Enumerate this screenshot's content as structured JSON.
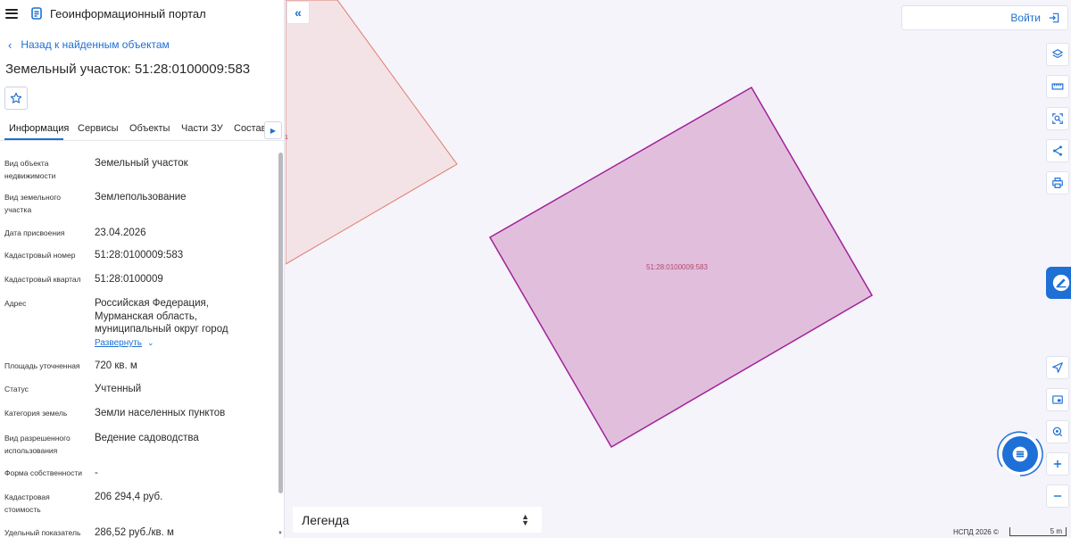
{
  "app": {
    "title": "Геоинформационный портал"
  },
  "nav": {
    "back_label": "Назад к найденным объектам"
  },
  "object": {
    "title": "Земельный участок: 51:28:0100009:583"
  },
  "tabs": [
    {
      "label": "Информация",
      "active": true
    },
    {
      "label": "Сервисы",
      "active": false
    },
    {
      "label": "Объекты",
      "active": false
    },
    {
      "label": "Части ЗУ",
      "active": false
    },
    {
      "label": "Состав",
      "active": false
    }
  ],
  "fields": [
    {
      "label": "Вид объекта недвижимости",
      "value": "Земельный участок"
    },
    {
      "label": "Вид земельного участка",
      "value": "Землепользование"
    },
    {
      "label": "Дата присвоения",
      "value": "23.04.2026"
    },
    {
      "label": "Кадастровый номер",
      "value": "51:28:0100009:583"
    },
    {
      "label": "Кадастровый квартал",
      "value": "51:28:0100009"
    },
    {
      "label": "Адрес",
      "value": "Российская Федерация, Мурманская область, муниципальный округ город Полярные Зори, населенный"
    },
    {
      "label": "Площадь уточненная",
      "value": "720 кв. м"
    },
    {
      "label": "Статус",
      "value": "Учтенный"
    },
    {
      "label": "Категория земель",
      "value": "Земли населенных пунктов"
    },
    {
      "label": "Вид разрешенного использования",
      "value": "Ведение садоводства"
    },
    {
      "label": "Форма собственности",
      "value": "-"
    },
    {
      "label": "Кадастровая стоимость",
      "value": "206 294,4 руб."
    },
    {
      "label": "Удельный показатель",
      "value": "286,52 руб./кв. м"
    }
  ],
  "expand_label": "Развернуть",
  "header": {
    "login_label": "Войти"
  },
  "map": {
    "parcel_label": "51:28:0100009:583",
    "neighbor_label": "1",
    "legend_label": "Легенда",
    "copyright": "НСПД 2026 ©",
    "scale_label": "5 m",
    "colors": {
      "background": "#f5f4fa",
      "parcel_fill": "#e2bedd",
      "parcel_stroke": "#a0229a",
      "neighbor_fill": "#f3e3e6",
      "neighbor_stroke": "#e07e6e",
      "accent": "#1e6fd6"
    }
  },
  "tools": [
    {
      "name": "layers-icon"
    },
    {
      "name": "ruler-icon"
    },
    {
      "name": "select-area-icon"
    },
    {
      "name": "share-icon"
    },
    {
      "name": "print-icon"
    },
    {
      "name": "navigate-icon"
    },
    {
      "name": "minimap-icon"
    },
    {
      "name": "locate-icon"
    },
    {
      "name": "zoom-in-icon"
    },
    {
      "name": "zoom-out-icon"
    }
  ]
}
